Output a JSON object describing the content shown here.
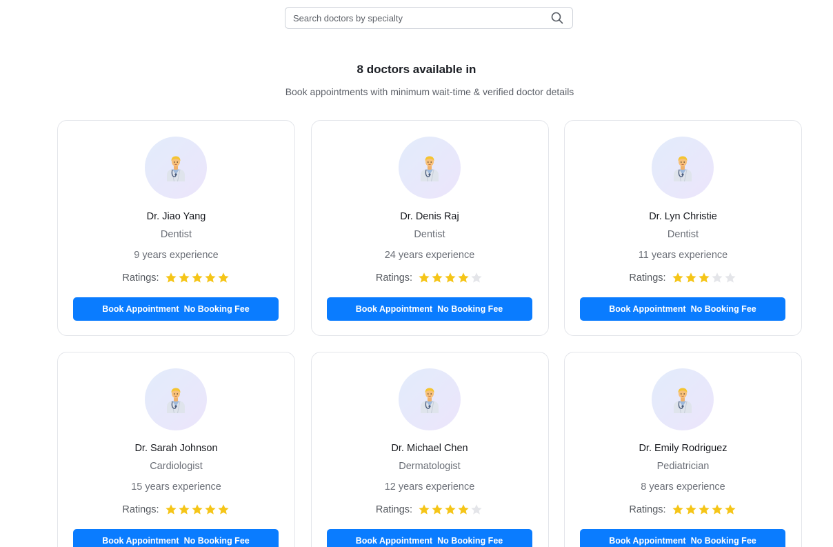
{
  "search": {
    "placeholder": "Search doctors by specialty",
    "value": "",
    "icon": "search-icon"
  },
  "header": {
    "title": "8 doctors available in",
    "subtitle": "Book appointments with minimum wait-time & verified doctor details"
  },
  "colors": {
    "accent": "#0a7cff",
    "star_filled": "#f5c518",
    "star_empty": "#e4e5e9",
    "avatar_bg_start": "#e2ecfb",
    "avatar_bg_end": "#ece5fb"
  },
  "ratings_label": "Ratings:",
  "rating_max": 5,
  "book_button": {
    "label": "Book Appointment",
    "suffix": "No Booking Fee"
  },
  "doctors": [
    {
      "name": "Dr. Jiao Yang",
      "specialty": "Dentist",
      "experience": "9 years experience",
      "rating": 5,
      "avatar_icon": "doctor-icon"
    },
    {
      "name": "Dr. Denis Raj",
      "specialty": "Dentist",
      "experience": "24 years experience",
      "rating": 4,
      "avatar_icon": "doctor-icon"
    },
    {
      "name": "Dr. Lyn Christie",
      "specialty": "Dentist",
      "experience": "11 years experience",
      "rating": 3,
      "avatar_icon": "doctor-icon"
    },
    {
      "name": "Dr. Sarah Johnson",
      "specialty": "Cardiologist",
      "experience": "15 years experience",
      "rating": 5,
      "avatar_icon": "doctor-icon"
    },
    {
      "name": "Dr. Michael Chen",
      "specialty": "Dermatologist",
      "experience": "12 years experience",
      "rating": 4,
      "avatar_icon": "doctor-icon"
    },
    {
      "name": "Dr. Emily Rodriguez",
      "specialty": "Pediatrician",
      "experience": "8 years experience",
      "rating": 5,
      "avatar_icon": "doctor-icon"
    }
  ]
}
